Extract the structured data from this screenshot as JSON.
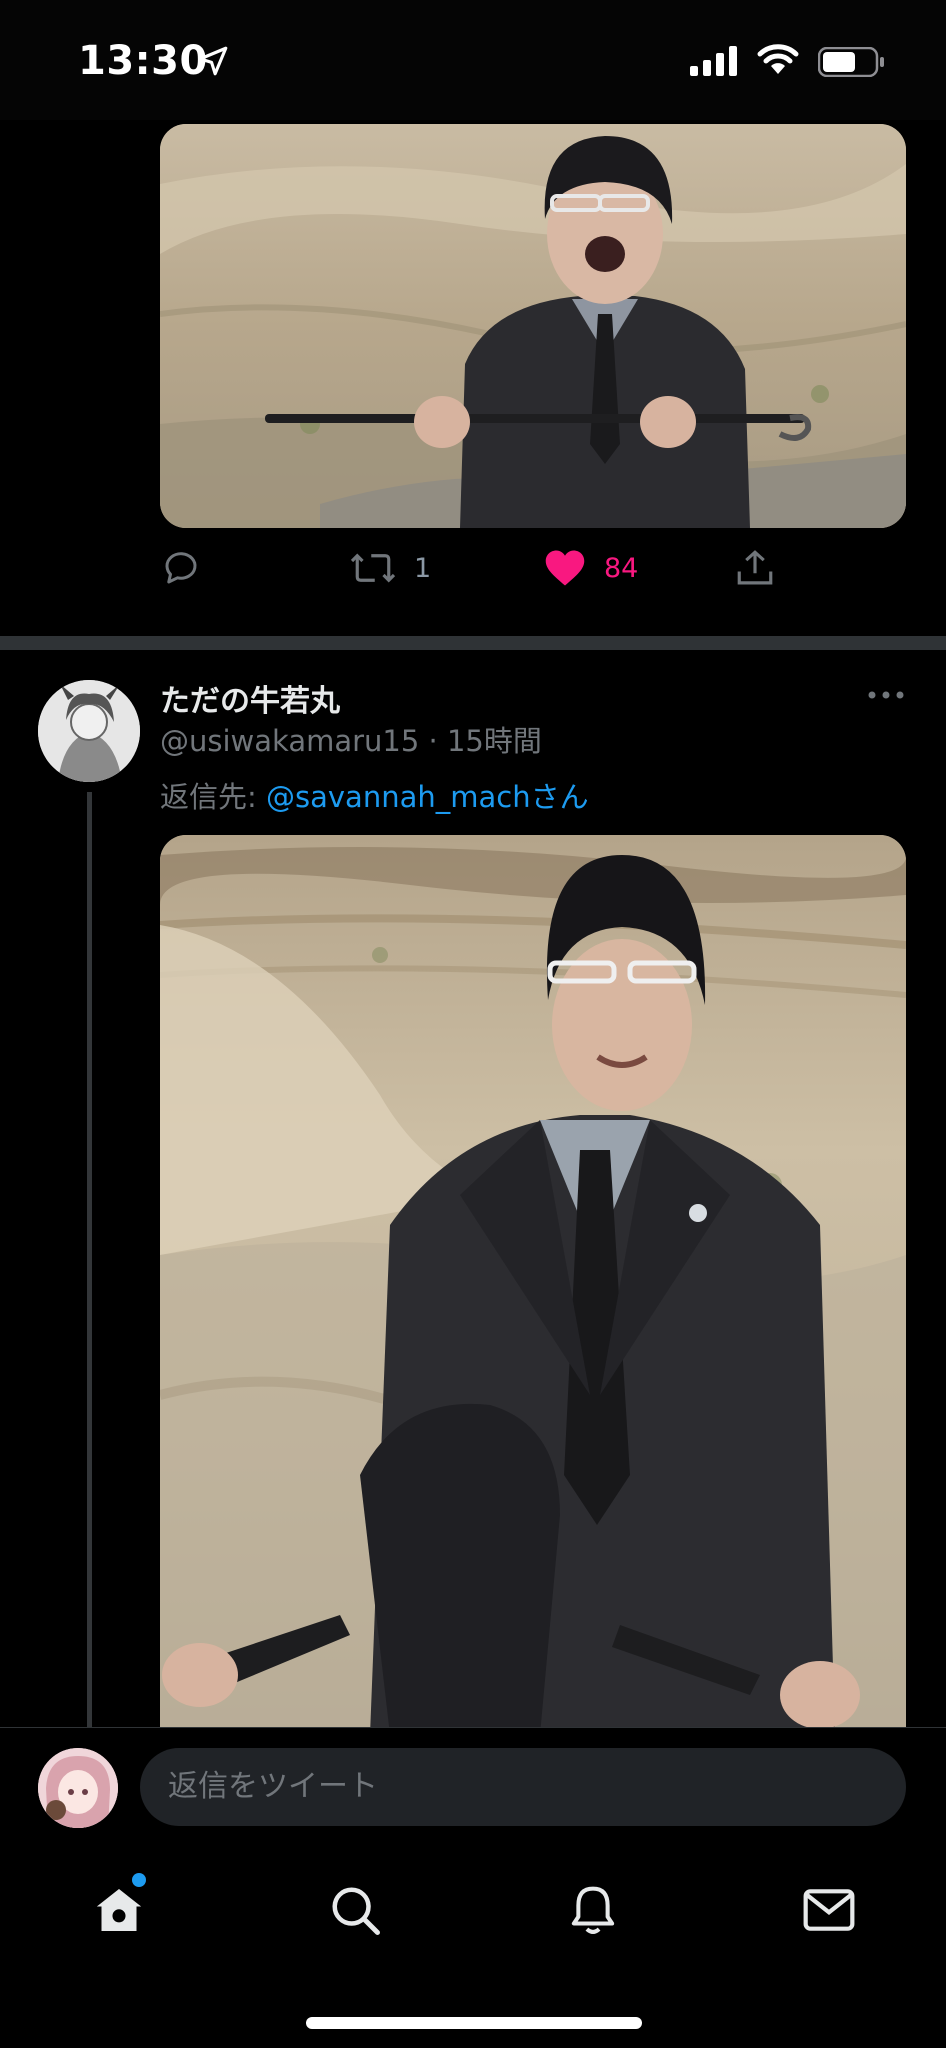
{
  "status_bar": {
    "time": "13:30",
    "icons": [
      "location-arrow-icon",
      "cellular-signal-icon",
      "wifi-icon",
      "battery-icon"
    ]
  },
  "previous_tweet": {
    "actions": {
      "reply_count": "",
      "retweet_count": "1",
      "like_count": "84",
      "liked": true
    }
  },
  "tweet": {
    "display_name": "ただの牛若丸",
    "handle": "@usiwakamaru15",
    "separator": "·",
    "timestamp": "15時間",
    "reply_prefix": "返信先:",
    "reply_to": "@savannah_mach",
    "reply_suffix": "さん"
  },
  "composer": {
    "placeholder": "返信をツイート"
  },
  "tabs": [
    {
      "icon": "home-icon",
      "has_notification_dot": true
    },
    {
      "icon": "search-icon"
    },
    {
      "icon": "bell-icon"
    },
    {
      "icon": "mail-icon"
    }
  ],
  "colors": {
    "background": "#000000",
    "accent": "#1d9bf0",
    "like": "#f91880",
    "secondary_text": "#71767b",
    "divider": "#2f3336"
  }
}
